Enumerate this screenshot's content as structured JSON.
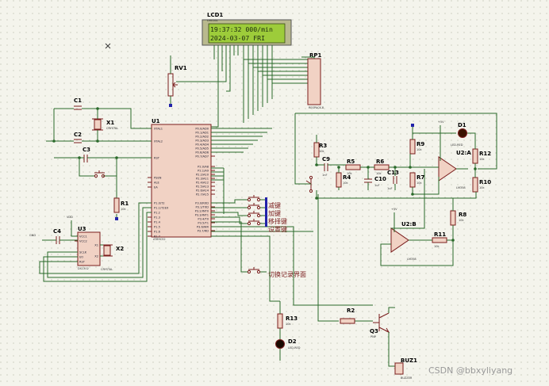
{
  "lcd": {
    "ref": "LCD1",
    "part": "LM016L",
    "line1": "19:37:32 000/min",
    "line2": "2024-03-07  FRI"
  },
  "components": {
    "rp1": {
      "ref": "RP1",
      "part": "RESPACK-8"
    },
    "rv1": {
      "ref": "RV1"
    },
    "u1": {
      "ref": "U1",
      "part": "AT89C52"
    },
    "u2a": {
      "ref": "U2:A",
      "part": "LM358"
    },
    "u2b": {
      "ref": "U2:B",
      "part": "LM358"
    },
    "u3": {
      "ref": "U3",
      "part": "DS1302"
    },
    "x1": {
      "ref": "X1",
      "part": "CRYSTAL"
    },
    "x2": {
      "ref": "X2",
      "part": "CRYSTAL"
    },
    "c1": {
      "ref": "C1"
    },
    "c2": {
      "ref": "C2"
    },
    "c3": {
      "ref": "C3"
    },
    "c4": {
      "ref": "C4"
    },
    "c9": {
      "ref": "C9",
      "val": "1nF"
    },
    "c10": {
      "ref": "C10",
      "val": "1uF"
    },
    "c13": {
      "ref": "C13",
      "val": "1uF"
    },
    "r1": {
      "ref": "R1",
      "val": "10k"
    },
    "r2": {
      "ref": "R2"
    },
    "r3": {
      "ref": "R3",
      "val": "10k"
    },
    "r4": {
      "ref": "R4",
      "val": "10k"
    },
    "r5": {
      "ref": "R5",
      "val": "10k"
    },
    "r6": {
      "ref": "R6",
      "val": "10k"
    },
    "r7": {
      "ref": "R7",
      "val": "10k"
    },
    "r8": {
      "ref": "R8",
      "val": "10k"
    },
    "r9": {
      "ref": "R9",
      "val": "10k"
    },
    "r10": {
      "ref": "R10",
      "val": "10k"
    },
    "r11": {
      "ref": "R11",
      "val": "10k"
    },
    "r12": {
      "ref": "R12",
      "val": "10k"
    },
    "r13": {
      "ref": "R13",
      "val": "10k"
    },
    "q3": {
      "ref": "Q3",
      "part": "PNP"
    },
    "d1": {
      "ref": "D1",
      "part": "LED-RED"
    },
    "d2": {
      "ref": "D2",
      "part": "LED-RED"
    },
    "buz1": {
      "ref": "BUZ1",
      "part": "BUZZER"
    },
    "vdd": "VDD",
    "vcc5": "+5V",
    "gnd": "GND"
  },
  "u1_pins_left": [
    "XTAL1",
    "XTAL2",
    "RST",
    "PSEN",
    "ALE",
    "EA",
    "P1.0/T2",
    "P1.1/T2EX",
    "P1.2",
    "P1.3",
    "P1.4",
    "P1.5",
    "P1.6",
    "P1.7"
  ],
  "u1_pins_right": [
    "P0.0/AD0",
    "P0.1/AD1",
    "P0.2/AD2",
    "P0.3/AD3",
    "P0.4/AD4",
    "P0.5/AD5",
    "P0.6/AD6",
    "P0.7/AD7",
    "P2.0/A8",
    "P2.1/A9",
    "P2.2/A10",
    "P2.3/A11",
    "P2.4/A12",
    "P2.5/A13",
    "P2.6/A14",
    "P2.7/A15",
    "P3.0/RXD",
    "P3.1/TXD",
    "P3.2/INT0",
    "P3.3/INT1",
    "P3.4/T0",
    "P3.5/T1",
    "P3.6/WR",
    "P3.7/RD"
  ],
  "u3_pins": [
    "VCC1",
    "VCC2",
    "SCLK",
    "I/O",
    "RST",
    "X1",
    "X2"
  ],
  "keys": {
    "minus": "减键",
    "plus": "加键",
    "shift": "移择键",
    "set": "设置键",
    "switch": "切换记录界面"
  },
  "watermark": "CSDN @bbxyliyang",
  "colors": {
    "background": "#f4f4ec",
    "wire": "#2a6a2a",
    "component": "#7a1d1d",
    "ic_fill": "#f1d2c4",
    "lcd_screen": "#9dcc3a",
    "led_dark": "#3a1200"
  }
}
